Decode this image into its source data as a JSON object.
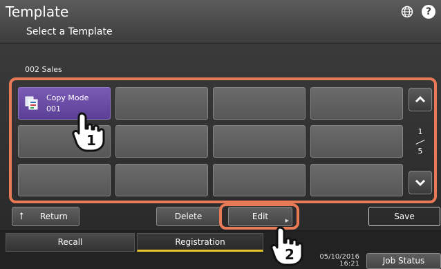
{
  "header": {
    "title": "Template",
    "subtitle": "Select a Template",
    "icons": [
      "globe-icon",
      "help-icon"
    ],
    "help_glyph": "?"
  },
  "group": {
    "label": "002 Sales"
  },
  "templates": {
    "selected": {
      "name": "Copy Mode",
      "number": "001",
      "icon": "copy-mode-icon"
    },
    "slots_total": 12,
    "page": {
      "current": "1",
      "total": "5"
    }
  },
  "actions": {
    "return_label": "Return",
    "delete_label": "Delete",
    "edit_label": "Edit",
    "save_label": "Save"
  },
  "tabs": [
    {
      "label": "Recall"
    },
    {
      "label": "Registration"
    }
  ],
  "footer": {
    "date": "05/10/2016",
    "time": "16:21",
    "job_status_label": "Job Status"
  },
  "callouts": {
    "step1": "1",
    "step2": "2"
  },
  "colors": {
    "highlight": "#e97a56",
    "selected_tile": "#6a4ca6",
    "active_tab_underline": "#e8c32a"
  }
}
